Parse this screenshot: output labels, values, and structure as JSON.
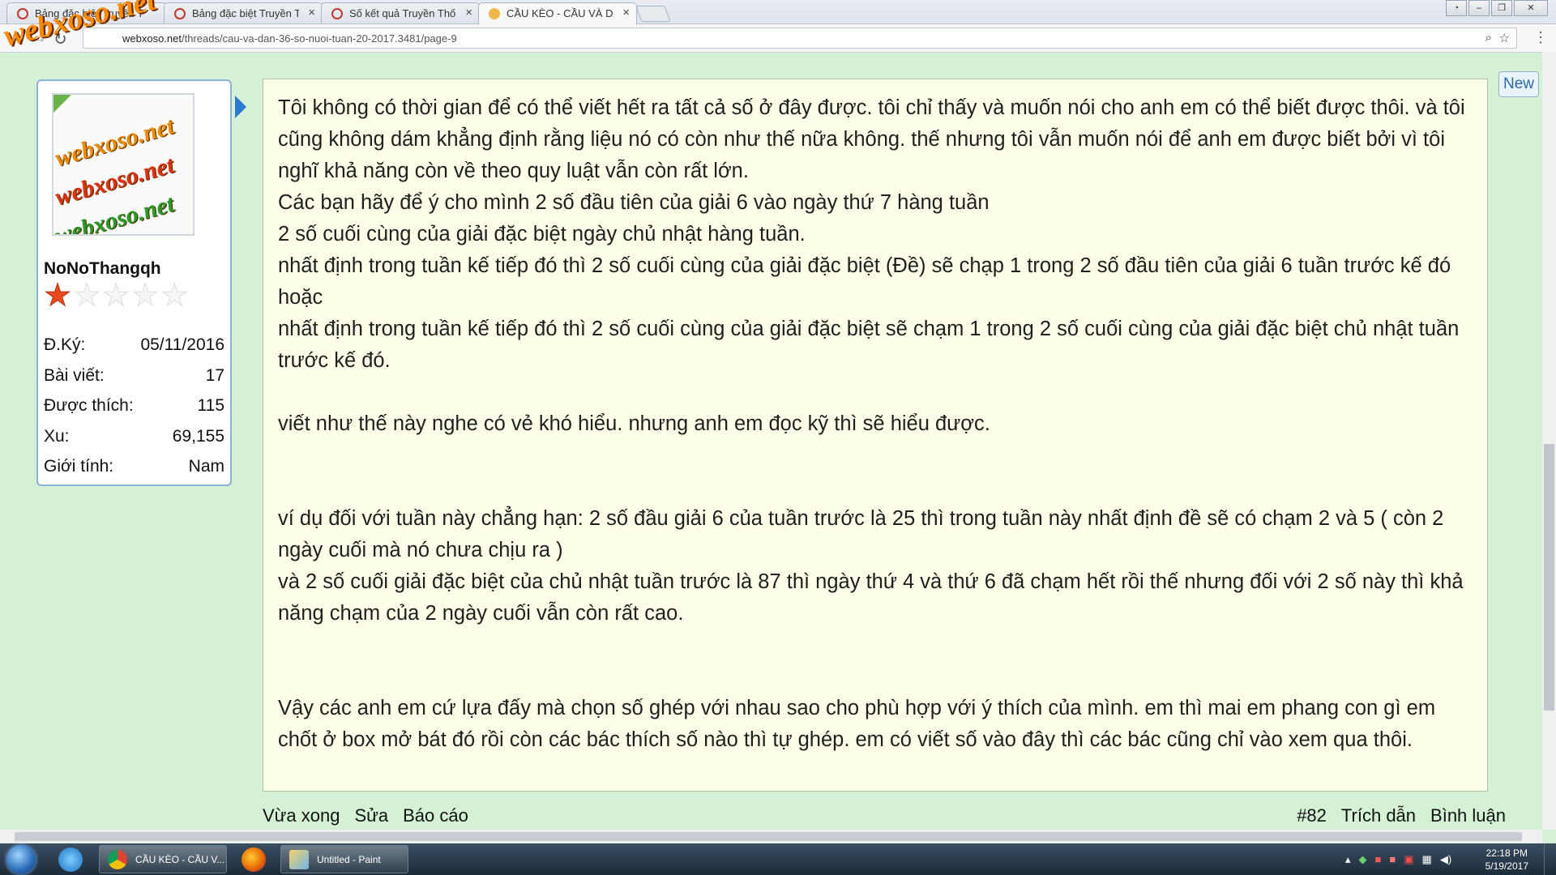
{
  "browser": {
    "tabs": [
      {
        "title": "Bảng đặc biệt Truyền Th"
      },
      {
        "title": "Bảng đặc biệt Truyền Th"
      },
      {
        "title": "Số kết quả Truyền Thống"
      },
      {
        "title": "CẦU KÈO - CẦU VÀ DÀN"
      }
    ],
    "url_domain": "webxoso.net",
    "url_path": "/threads/cau-va-dan-36-so-nuoi-tuan-20-2017.3481/page-9",
    "watermark": "webxoso.net"
  },
  "user": {
    "avatar_text": "webxoso.net",
    "name": "NoNoThangqh",
    "rating": 1,
    "rating_max": 5,
    "stats": [
      {
        "label": "Đ.Ký:",
        "value": "05/11/2016"
      },
      {
        "label": "Bài viết:",
        "value": "17"
      },
      {
        "label": "Được thích:",
        "value": "115"
      },
      {
        "label": "Xu:",
        "value": "69,155"
      },
      {
        "label": "Giới tính:",
        "value": "Nam"
      }
    ]
  },
  "post": {
    "badge": "New",
    "paragraphs": [
      "Tôi không có thời gian để có thể viết hết ra tất cả số ở đây được. tôi chỉ thấy và muốn nói cho anh em có thể biết được thôi. và tôi cũng không dám khẳng định rằng liệu nó có còn như thế nữa không. thế nhưng tôi vẫn muốn nói để anh em được biết bởi vì tôi nghĩ khả năng còn về theo quy luật vẫn còn rất lớn.",
      "Các bạn hãy để ý cho mình 2 số đầu tiên của giải 6 vào ngày thứ 7 hàng tuần",
      "2 số cuối cùng của giải đặc biệt ngày chủ nhật hàng tuần.",
      "nhất định trong tuần kế tiếp đó thì 2 số cuối cùng của giải đặc biệt (Đề) sẽ chạp 1 trong 2 số đầu tiên của giải 6 tuần trước kế đó hoặc",
      "nhất định trong tuần kế tiếp đó thì 2 số cuối cùng của giải đặc biệt sẽ chạm 1 trong 2 số cuối cùng của giải đặc biệt chủ nhật tuần trước kế đó.",
      "",
      "viết như thế này nghe có vẻ khó hiểu. nhưng anh em đọc kỹ thì sẽ hiểu được.",
      "",
      "",
      "ví dụ đối với tuần này chẳng hạn: 2 số đầu giải 6 của tuần trước là 25 thì trong tuần này nhất định đề sẽ có chạm 2 và 5 ( còn 2 ngày cuối mà nó chưa chịu ra )",
      "và 2 số cuối giải đặc biệt của chủ nhật tuần trước là 87 thì ngày thứ 4 và thứ 6 đã chạm hết rồi thế nhưng đối với 2 số này thì khả năng chạm của 2 ngày cuối vẫn còn rất cao.",
      "",
      "",
      "Vậy các anh em cứ lựa đấy mà chọn số ghép với nhau sao cho phù hợp với ý thích của mình. em thì mai em phang con gì em chốt ở box mở bát đó rồi còn các bác thích số nào thì tự ghép. em có viết số vào đây thì các bác cũng chỉ vào xem qua thôi."
    ],
    "footer_left": [
      "Vừa xong",
      "Sửa",
      "Báo cáo"
    ],
    "footer_right": [
      "#82",
      "Trích dẫn",
      "Bình luận"
    ]
  },
  "taskbar": {
    "items": [
      {
        "label": "CẦU KÈO - CẦU V..."
      },
      {
        "label": "Untitled - Paint"
      }
    ],
    "time": "22:18 PM",
    "date": "5/19/2017"
  }
}
